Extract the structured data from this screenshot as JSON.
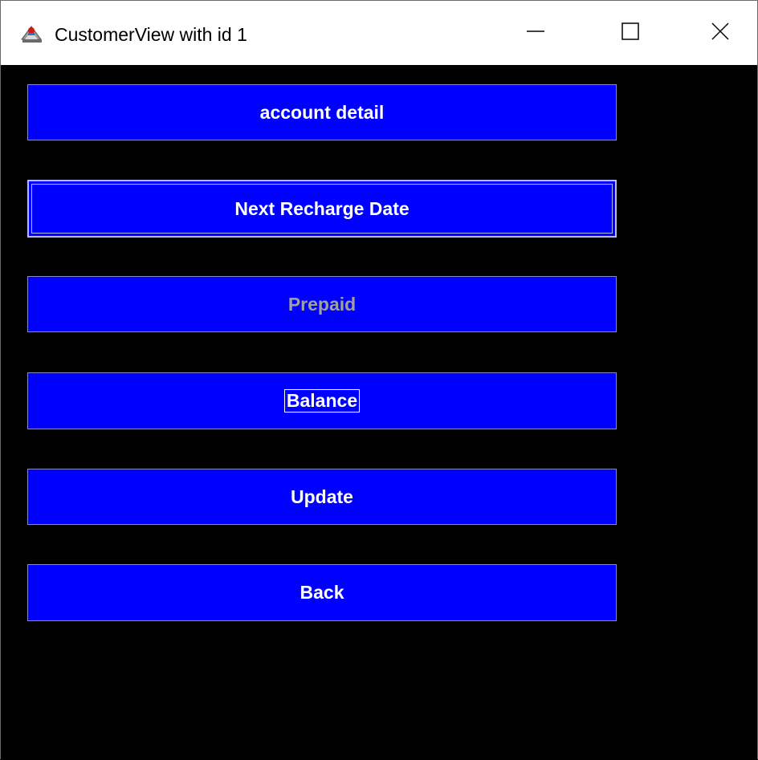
{
  "window": {
    "title": "CustomerView with id 1",
    "app_icon": "java-cup-icon",
    "controls": {
      "minimize_icon": "minimize-icon",
      "maximize_icon": "maximize-icon",
      "close_icon": "close-icon"
    }
  },
  "buttons": {
    "account_detail": "account detail",
    "next_recharge_date": "Next Recharge Date",
    "prepaid": "Prepaid",
    "balance": "Balance",
    "update": "Update",
    "back": "Back"
  },
  "colors": {
    "background": "#000000",
    "button_fill": "#0000ff",
    "button_text": "#ffffff",
    "disabled_text": "#a0a0a0",
    "titlebar": "#ffffff"
  }
}
